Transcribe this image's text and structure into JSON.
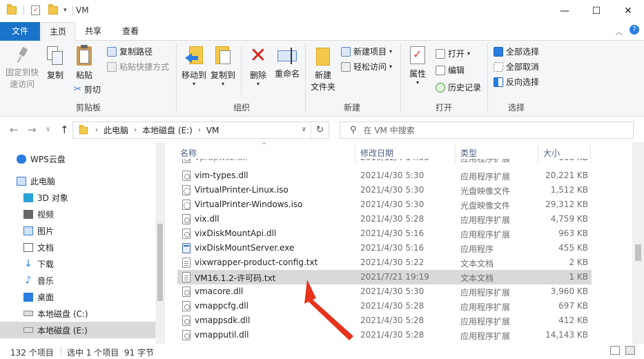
{
  "window": {
    "title": "VM",
    "minimize_glyph": "—",
    "maximize_glyph": "☐",
    "close_glyph": "✕"
  },
  "ribbon_tabs": [
    "文件",
    "主页",
    "共享",
    "查看"
  ],
  "ribbon": {
    "clipboard": {
      "pin": "固定到快\n速访问",
      "copy": "复制",
      "paste": "粘贴",
      "copy_path": "复制路径",
      "paste_shortcut": "粘贴快捷方式",
      "cut": "剪切",
      "label": "剪贴板"
    },
    "organize": {
      "move_to": "移动到",
      "copy_to": "复制到",
      "delete": "删除",
      "rename": "重命名",
      "label": "组织"
    },
    "new": {
      "new_folder": "新建\n文件夹",
      "new_item": "新建项目",
      "easy_access": "轻松访问",
      "label": "新建"
    },
    "open": {
      "properties": "属性",
      "open": "打开",
      "edit": "编辑",
      "history": "历史记录",
      "label": "打开"
    },
    "select": {
      "select_all": "全部选择",
      "select_none": "全部取消",
      "invert": "反向选择",
      "label": "选择"
    }
  },
  "address": {
    "crumbs": [
      "此电脑",
      "本地磁盘 (E:)",
      "VM"
    ],
    "search_placeholder": "在 VM 中搜索"
  },
  "nav_pane": {
    "items": [
      {
        "label": "WPS云盘",
        "icon": "cloud-icon",
        "color": "#2a7de1"
      },
      {
        "label": "此电脑",
        "icon": "computer-icon",
        "color": "#3a7bd5"
      },
      {
        "label": "3D 对象",
        "icon": "cube-icon",
        "color": "#29a3d6"
      },
      {
        "label": "视频",
        "icon": "video-icon",
        "color": "#555"
      },
      {
        "label": "图片",
        "icon": "picture-icon",
        "color": "#3a7bd5"
      },
      {
        "label": "文档",
        "icon": "document-icon",
        "color": "#555"
      },
      {
        "label": "下载",
        "icon": "download-icon",
        "color": "#2a7de1"
      },
      {
        "label": "音乐",
        "icon": "music-icon",
        "color": "#2a7de1"
      },
      {
        "label": "桌面",
        "icon": "desktop-icon",
        "color": "#2a7de1"
      },
      {
        "label": "本地磁盘 (C:)",
        "icon": "drive-icon",
        "color": "#666"
      },
      {
        "label": "本地磁盘 (E:)",
        "icon": "drive-icon",
        "color": "#666"
      }
    ]
  },
  "columns": {
    "name": "名称",
    "date": "修改日期",
    "type": "类型",
    "size": "大小"
  },
  "files": [
    {
      "name": "vim-types.dll",
      "date": "2021/4/30 5:30",
      "type": "应用程序扩展",
      "size": "20,221 KB",
      "kind": "dll"
    },
    {
      "name": "VirtualPrinter-Linux.iso",
      "date": "2021/4/30 5:30",
      "type": "光盘映像文件",
      "size": "1,512 KB",
      "kind": "iso"
    },
    {
      "name": "VirtualPrinter-Windows.iso",
      "date": "2021/4/30 5:30",
      "type": "光盘映像文件",
      "size": "29,312 KB",
      "kind": "iso"
    },
    {
      "name": "vix.dll",
      "date": "2021/4/30 5:28",
      "type": "应用程序扩展",
      "size": "4,759 KB",
      "kind": "dll"
    },
    {
      "name": "vixDiskMountApi.dll",
      "date": "2021/4/30 5:16",
      "type": "应用程序扩展",
      "size": "963 KB",
      "kind": "dll"
    },
    {
      "name": "vixDiskMountServer.exe",
      "date": "2021/4/30 5:16",
      "type": "应用程序",
      "size": "455 KB",
      "kind": "exe"
    },
    {
      "name": "vixwrapper-product-config.txt",
      "date": "2021/4/30 5:22",
      "type": "文本文档",
      "size": "2 KB",
      "kind": "txt"
    },
    {
      "name": "VM16.1.2-许可码.txt",
      "date": "2021/7/21 19:19",
      "type": "文本文档",
      "size": "1 KB",
      "kind": "txt"
    },
    {
      "name": "vmacore.dll",
      "date": "2021/4/30 5:30",
      "type": "应用程序扩展",
      "size": "3,960 KB",
      "kind": "dll"
    },
    {
      "name": "vmappcfg.dll",
      "date": "2021/4/30 5:28",
      "type": "应用程序扩展",
      "size": "697 KB",
      "kind": "dll"
    },
    {
      "name": "vmappsdk.dll",
      "date": "2021/4/30 5:28",
      "type": "应用程序扩展",
      "size": "412 KB",
      "kind": "dll"
    },
    {
      "name": "vmapputil.dll",
      "date": "2021/4/30 5:28",
      "type": "应用程序扩展",
      "size": "14,143 KB",
      "kind": "dll"
    }
  ],
  "status": {
    "count": "132 个项目",
    "selection": "选中 1 个项目  91 字节"
  },
  "accent": "#1a73c8",
  "annotation_color": "#e8331c"
}
